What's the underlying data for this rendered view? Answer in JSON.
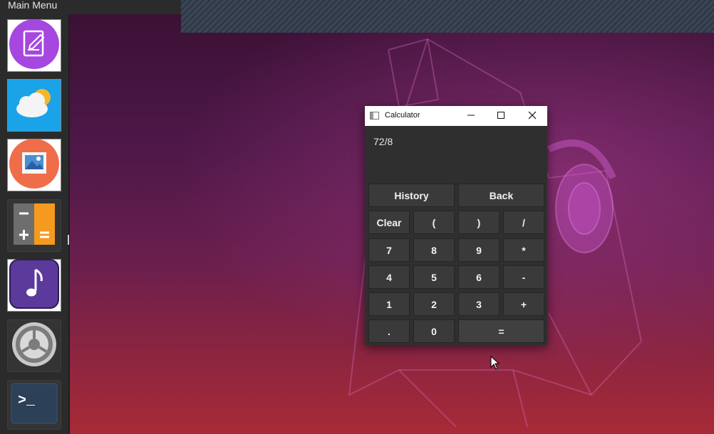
{
  "dock": {
    "title": "Main Menu",
    "apps": [
      {
        "name": "text-editor",
        "icon": "pencil-note-icon"
      },
      {
        "name": "weather",
        "icon": "weather-cloud-sun-icon"
      },
      {
        "name": "image-viewer",
        "icon": "picture-icon"
      },
      {
        "name": "calculator",
        "icon": "calculator-icon"
      },
      {
        "name": "music",
        "icon": "music-note-icon"
      },
      {
        "name": "settings",
        "icon": "gear-icon"
      },
      {
        "name": "terminal",
        "icon": "terminal-icon",
        "glyph": ">_"
      }
    ]
  },
  "calculator": {
    "window_title": "Calculator",
    "display": "72/8",
    "buttons": {
      "history": "History",
      "back": "Back",
      "clear": "Clear",
      "lparen": "(",
      "rparen": ")",
      "divide": "/",
      "seven": "7",
      "eight": "8",
      "nine": "9",
      "multiply": "*",
      "four": "4",
      "five": "5",
      "six": "6",
      "minus": "-",
      "one": "1",
      "two": "2",
      "three": "3",
      "plus": "+",
      "dot": ".",
      "zero": "0",
      "equals": "="
    }
  },
  "colors": {
    "dock_bg": "#2b2b2b",
    "calc_bg": "#2f2f2f",
    "button_bg": "#3a3a3a",
    "accent_purple": "#a647e0"
  }
}
